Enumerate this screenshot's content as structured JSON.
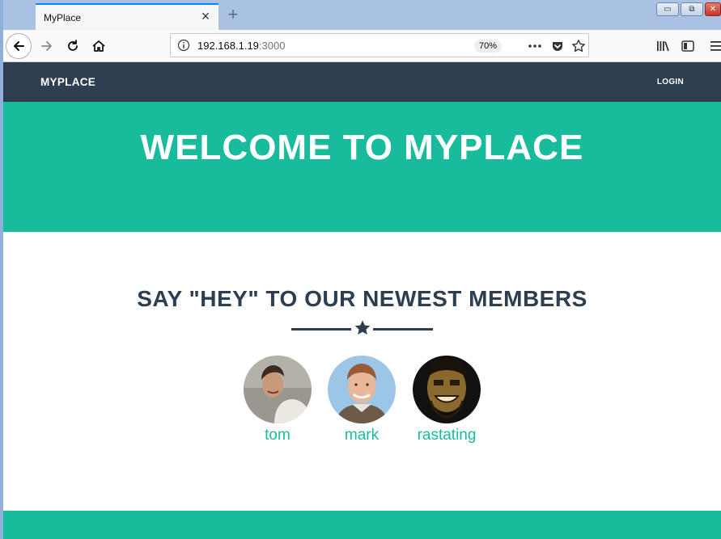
{
  "browser": {
    "tab_title": "MyPlace",
    "url_host": "192.168.1.19",
    "url_port": ":3000",
    "zoom": "70%"
  },
  "site": {
    "brand": "MYPLACE",
    "login_label": "LOGIN",
    "hero_title": "WELCOME TO MYPLACE",
    "section_title": "SAY \"HEY\" TO OUR NEWEST MEMBERS",
    "members": [
      {
        "name": "tom"
      },
      {
        "name": "mark"
      },
      {
        "name": "rastating"
      }
    ]
  },
  "colors": {
    "navy": "#2c3e50",
    "teal": "#18bc9c",
    "white": "#ffffff"
  },
  "icons": [
    "back-arrow-icon",
    "forward-arrow-icon",
    "reload-icon",
    "home-icon",
    "info-icon",
    "more-icon",
    "pocket-icon",
    "bookmark-star-icon",
    "library-icon",
    "sidebar-icon",
    "menu-icon",
    "star-icon"
  ]
}
